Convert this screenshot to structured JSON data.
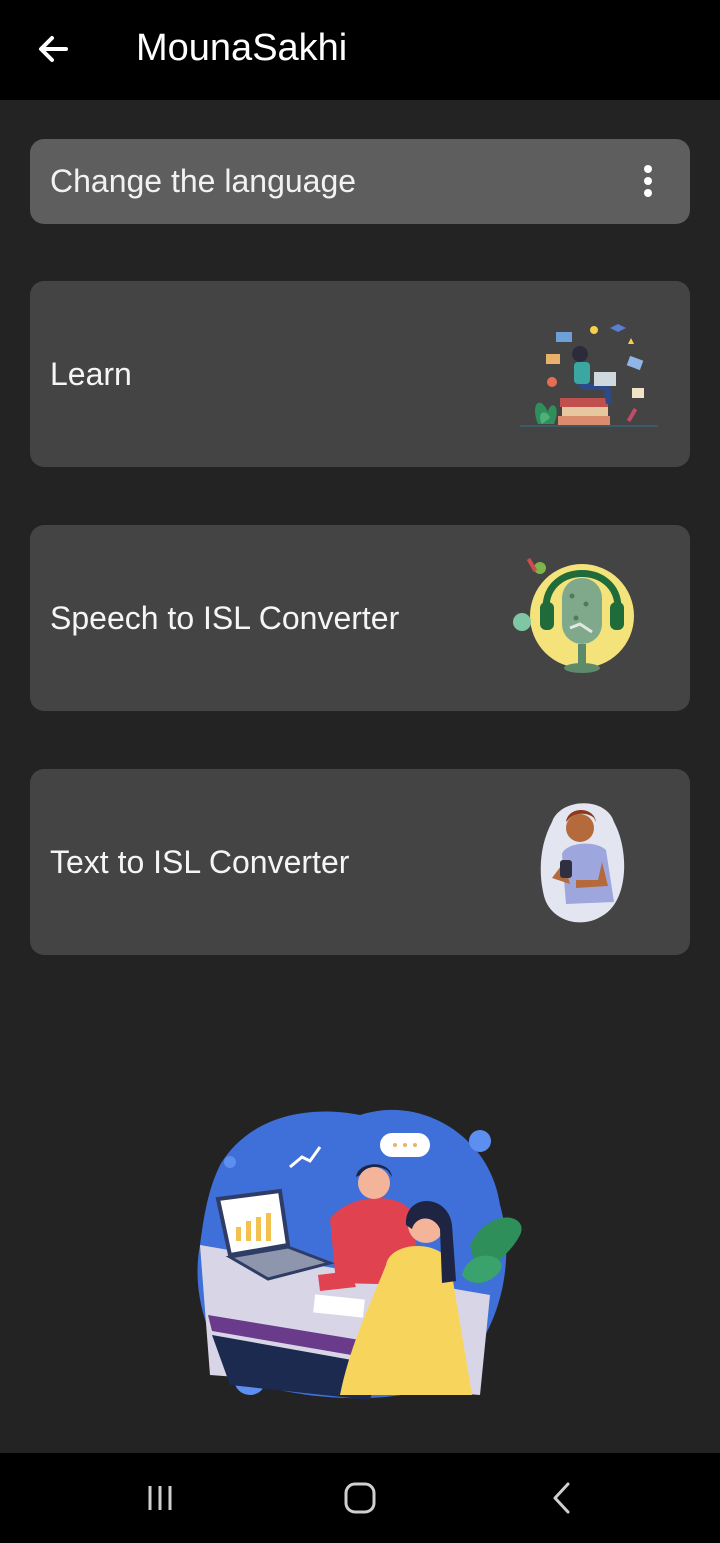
{
  "appbar": {
    "title": "MounaSakhi",
    "back_icon": "arrow-left-icon"
  },
  "language": {
    "label": "Change the language",
    "menu_icon": "more-vertical-icon"
  },
  "cards": [
    {
      "label": "Learn",
      "illustration": "student-studying-illustration"
    },
    {
      "label": "Speech to ISL Converter",
      "illustration": "microphone-headphones-illustration"
    },
    {
      "label": "Text to ISL Converter",
      "illustration": "person-with-phone-illustration"
    }
  ],
  "hero": {
    "illustration": "team-meeting-illustration"
  },
  "navbar": {
    "recents_icon": "recent-apps-icon",
    "home_icon": "home-icon",
    "back_icon": "nav-back-icon"
  },
  "colors": {
    "background": "#232323",
    "appbar": "#000000",
    "language_bar": "#5e5e5e",
    "card": "#444444"
  }
}
